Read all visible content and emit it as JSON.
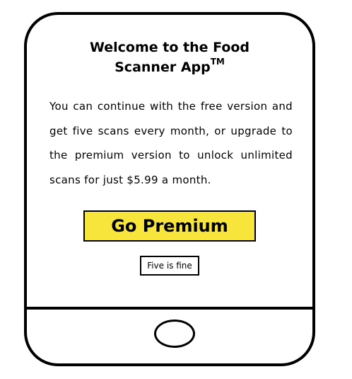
{
  "screen": {
    "title_line1": "Welcome to the Food",
    "title_line2": "Scanner App",
    "title_mark": "TM",
    "message": "You can continue with the free version and get five scans every month, or upgrade to the premium version to unlock unlimited scans for just $5.99 a month.",
    "premium_label": "Go Premium",
    "free_label": "Five is fine"
  },
  "colors": {
    "premium_button": "#f7e53b",
    "outline": "#000000",
    "background": "#ffffff"
  },
  "icons": {
    "home": "home-button-circle"
  }
}
